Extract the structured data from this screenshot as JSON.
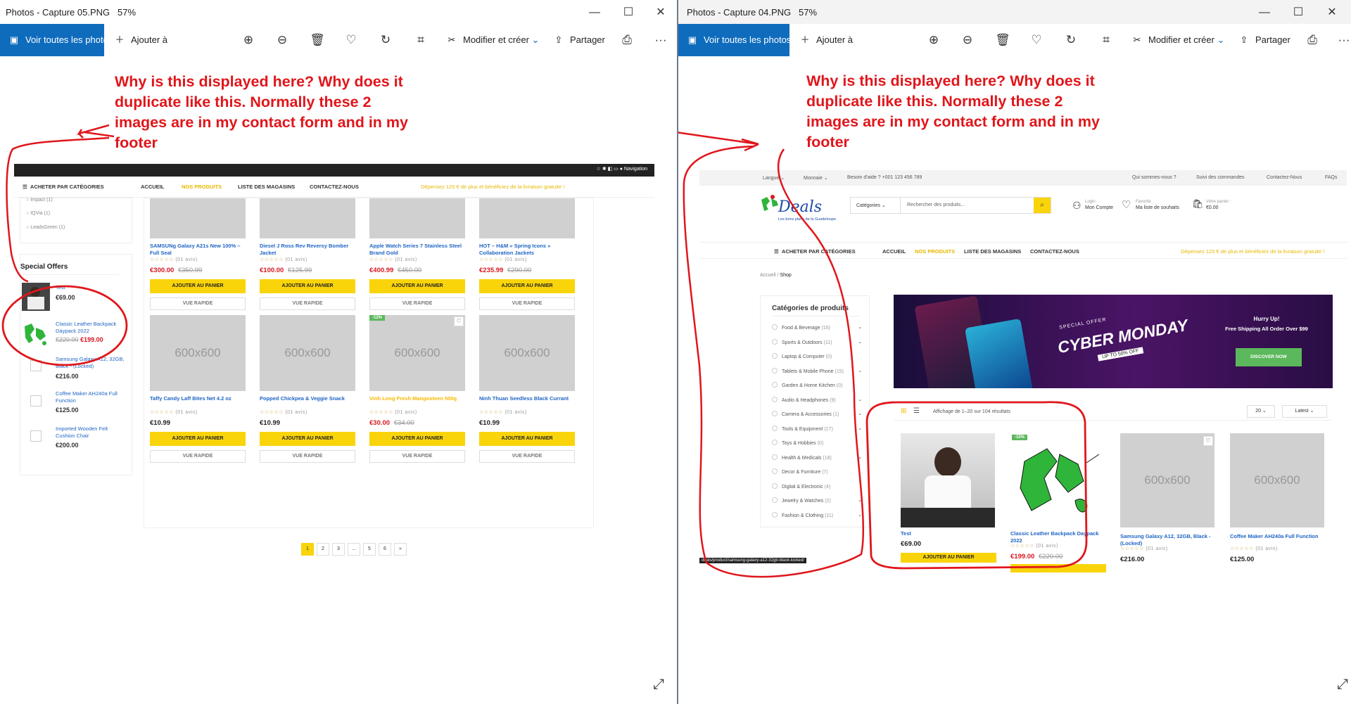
{
  "left_window": {
    "title": "Photos - Capture 05.PNG",
    "zoom": "57%",
    "toolbar": {
      "view_all": "Voir toutes les photos",
      "add_to": "Ajouter à",
      "edit_create": "Modifier et créer",
      "share": "Partager",
      "more": "···"
    },
    "annotation": "Why is this displayed here? Why does it duplicate like this.  Normally these 2 images are in my contact form and in my footer",
    "site": {
      "nav_browser_label": "Navigation",
      "cat_button": "ACHETER PAR CATÉGORIES",
      "nav": [
        "ACCUEIL",
        "NOS PRODUITS",
        "LISTE DES MAGASINS",
        "CONTACTEZ-NOUS"
      ],
      "promo": "Dépensez 120 € de plus et bénéficiez de la livraison gratuite !",
      "filters": [
        {
          "label": "Impact",
          "count": "(1)"
        },
        {
          "label": "IQVia",
          "count": "(1)"
        },
        {
          "label": "LeadsGreen",
          "count": "(1)"
        }
      ],
      "special_offers_title": "Special Offers",
      "special_offers": [
        {
          "name": "Test",
          "price": "€69.00",
          "old": ""
        },
        {
          "name": "Classic Leather Backpack Daypack 2022",
          "price": "€199.00",
          "old": "€220.00"
        },
        {
          "name": "Samsung Galaxy A12, 32GB, Black - (Locked)",
          "price": "€216.00",
          "old": ""
        },
        {
          "name": "Coffee Maker AH240a Full Function",
          "price": "€125.00",
          "old": ""
        },
        {
          "name": "Imported Wooden Felt Cushion Chair",
          "price": "€200.00",
          "old": ""
        }
      ],
      "placeholder": "600x600",
      "rating": "(01 avis)",
      "rating0": "(0 avis)",
      "add_btn": "AJOUTER AU PANIER",
      "quick_btn": "VUE RAPIDE",
      "row1": [
        {
          "name": "SAMSUNg Galaxy A21s New 100% – Full Seal",
          "price": "€300.00",
          "old": "€350.99",
          "sale": true
        },
        {
          "name": "Diesel J Ross Rev Reversy Bomber Jacket",
          "price": "€100.00",
          "old": "€125.99",
          "sale": true
        },
        {
          "name": "Apple Watch Series 7 Stainless Steel Brand Gold",
          "price": "€400.99",
          "old": "€450.00",
          "sale": true
        },
        {
          "name": "HOT – H&M « Spring Icons » Collaboration Jackets",
          "price": "€235.99",
          "old": "€290.00",
          "sale": true
        }
      ],
      "row2": [
        {
          "name": "Taffy Candy Laff Bites Net 4.2 oz",
          "price": "€10.99",
          "old": "",
          "sale": false
        },
        {
          "name": "Popped Chickpea & Veggie Snack",
          "price": "€10.99",
          "old": "",
          "sale": false
        },
        {
          "name": "Vinh Long Fresh Mangosteen 500g",
          "price": "€30.00",
          "old": "€34.00",
          "sale": true,
          "badge": "-12%"
        },
        {
          "name": "Ninh Thuan Seedless Black Currant",
          "price": "€10.99",
          "old": "",
          "sale": false
        }
      ],
      "pagination": [
        "1",
        "2",
        "3",
        "...",
        "5",
        "6",
        "»"
      ]
    }
  },
  "right_window": {
    "title": "Photos - Capture 04.PNG",
    "zoom": "57%",
    "annotation": "Why is this displayed here? Why does it duplicate like this.  Normally these 2 images are in my contact form and in my footer",
    "site": {
      "topbar_left": [
        "Langue",
        "Monnaie",
        "Besoin d'aide ? +001 123 456 789"
      ],
      "topbar_right": [
        "Qui sommes-nous ?",
        "Suivi des commandes",
        "Contactez-Nous",
        "FAQs"
      ],
      "logo": "Deals",
      "logo_tagline": "Les bons plans de la Guadeloupe",
      "search_cat": "Catégories",
      "search_placeholder": "Rechercher des produits...",
      "login_small": "Login",
      "login_big": "Mon Compte",
      "fav_small": "Favorite",
      "fav_big": "Ma liste de souhaits",
      "cart_small": "Votre panier :",
      "cart_big": "€0.00",
      "breadcrumb": [
        "Accueil",
        "Shop"
      ],
      "cats_title": "Catégories de produits",
      "cats": [
        {
          "label": "Food & Beverage",
          "count": "(16)"
        },
        {
          "label": "Sports & Outdoors",
          "count": "(11)"
        },
        {
          "label": "Laptop & Computer",
          "count": "(0)"
        },
        {
          "label": "Tablets & Mobile Phone",
          "count": "(15)"
        },
        {
          "label": "Garden & Home Kitchen",
          "count": "(0)"
        },
        {
          "label": "Audio & Headphones",
          "count": "(9)"
        },
        {
          "label": "Camera & Accessories",
          "count": "(1)"
        },
        {
          "label": "Tools & Equipment",
          "count": "(17)"
        },
        {
          "label": "Toys & Hobbies",
          "count": "(0)"
        },
        {
          "label": "Health & Medicals",
          "count": "(18)"
        },
        {
          "label": "Decor & Furniture",
          "count": "(7)"
        },
        {
          "label": "Digital & Electronic",
          "count": "(4)"
        },
        {
          "label": "Jewelry & Watches",
          "count": "(2)"
        },
        {
          "label": "Fashion & Clothing",
          "count": "(11)"
        }
      ],
      "banner_hurry": "Hurry Up!",
      "banner_ship": "Free Shipping All Order Over $99",
      "banner_special": "SPECIAL OFFER",
      "banner_cyber": "CYBER MONDAY",
      "banner_upto": "UP TO 50% OFF",
      "banner_btn": "DISCOVER NOW",
      "results": "Affichage de 1–20 sur 104 résultats",
      "per_page": "20",
      "sort": "Latest",
      "products": [
        {
          "name": "Test",
          "price": "€69.00",
          "old": ""
        },
        {
          "name": "Classic Leather Backpack Daypack 2022",
          "price": "€199.00",
          "old": "€220.00",
          "badge": "-10%"
        },
        {
          "name": "Samsung Galaxy A12, 32GB, Black - (Locked)",
          "price": "€216.00",
          "old": ""
        },
        {
          "name": "Coffee Maker AH240a Full Function",
          "price": "€125.00",
          "old": ""
        }
      ],
      "status_url": "deals/product/samsung-galaxy-a12-32gb-black-locked/"
    }
  },
  "colors": {
    "accent": "#0f6cbd",
    "yellow": "#f9d40b",
    "annotation": "#e0161b",
    "link": "#1f65c4",
    "sale": "#d71920",
    "green": "#5cb85c"
  }
}
